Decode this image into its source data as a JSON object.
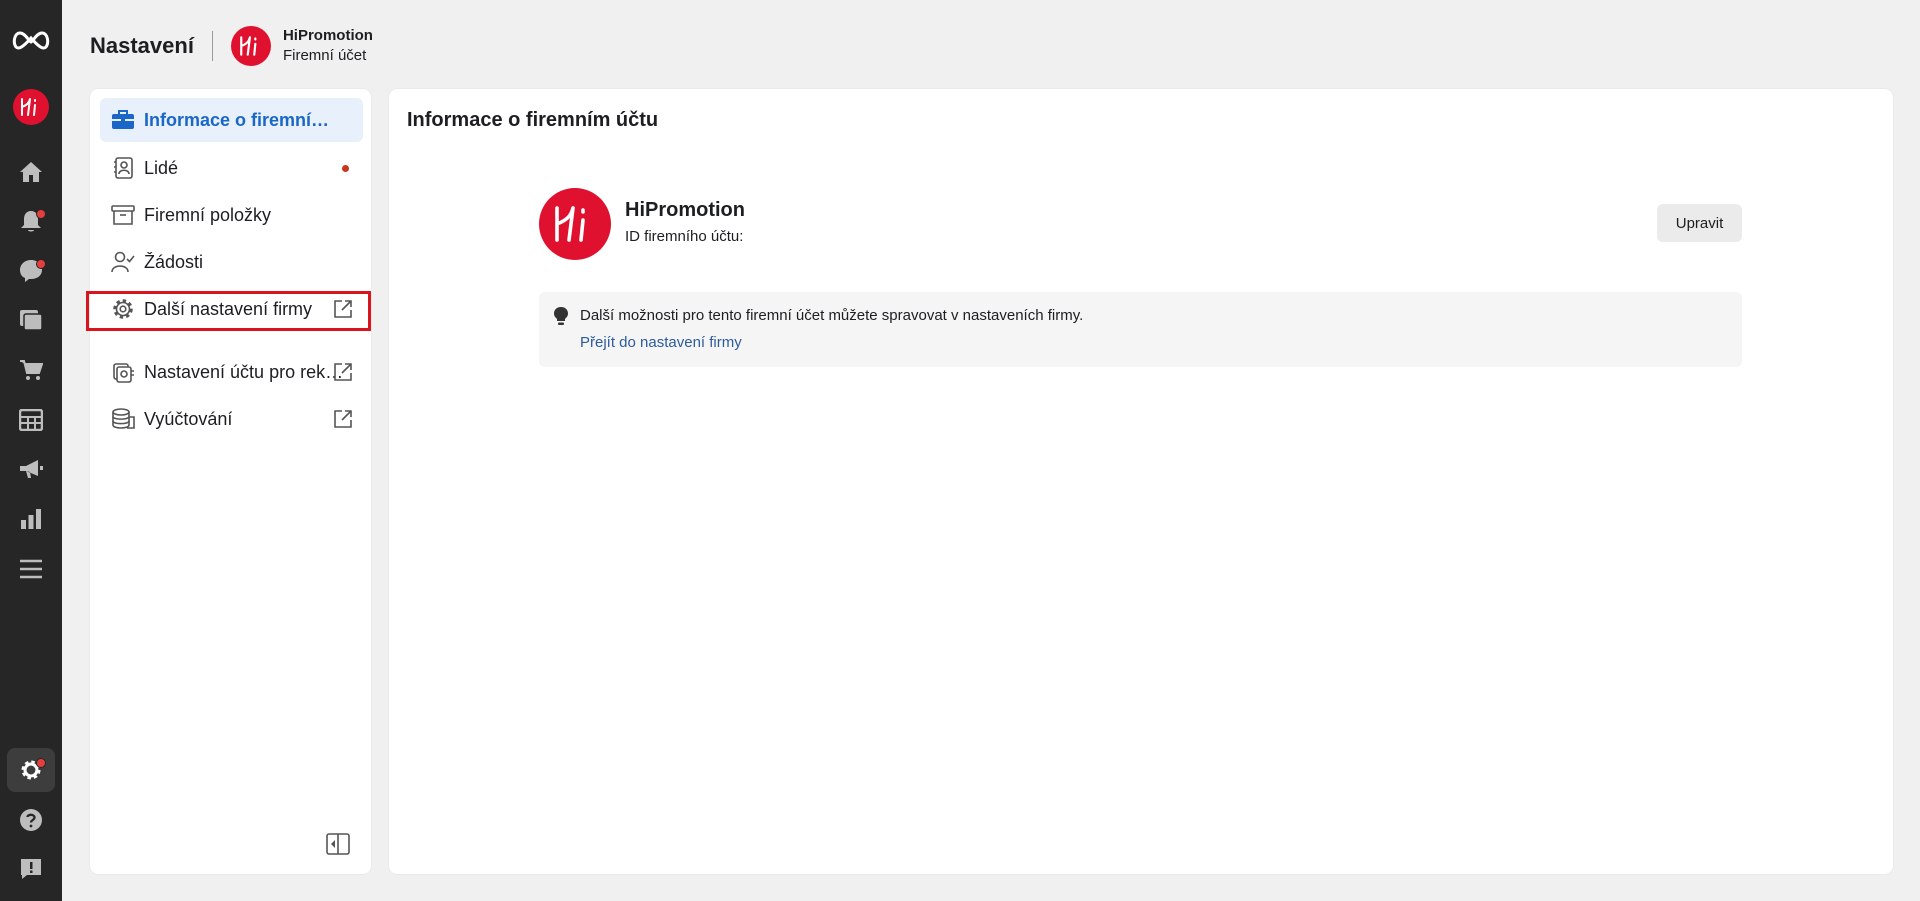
{
  "header": {
    "title": "Nastavení",
    "business_name": "HiPromotion",
    "business_type": "Firemní účet",
    "avatar_text": "Hi"
  },
  "rail": {
    "icons": [
      "meta-logo-icon",
      "business-avatar",
      "home-icon",
      "notifications-icon",
      "messages-icon",
      "pages-icon",
      "shop-icon",
      "table-icon",
      "ads-icon",
      "insights-icon",
      "menu-icon",
      "settings-icon",
      "help-icon",
      "feedback-icon"
    ]
  },
  "sidebar": {
    "items": [
      {
        "label": "Informace o firemním účtu",
        "icon": "briefcase-icon",
        "selected": true
      },
      {
        "label": "Lidé",
        "icon": "people-icon",
        "badge": true
      },
      {
        "label": "Firemní položky",
        "icon": "archive-icon"
      },
      {
        "label": "Žádosti",
        "icon": "person-check-icon"
      },
      {
        "label": "Další nastavení firmy",
        "icon": "gear-icon",
        "external": true
      },
      {
        "label": "Nastavení účtu pro reklamy",
        "icon": "ad-account-icon",
        "external": true
      },
      {
        "label": "Vyúčtování",
        "icon": "billing-icon",
        "external": true
      }
    ]
  },
  "main": {
    "title": "Informace o firemním účtu",
    "business_name": "HiPromotion",
    "business_id_label": "ID firemního účtu:",
    "edit_label": "Upravit",
    "info_text": "Další možnosti pro tento firemní účet můžete spravovat v nastaveních firmy.",
    "info_link": "Přejít do nastavení firmy"
  },
  "colors": {
    "accent": "#1b67c8",
    "brand": "#e0102f",
    "rail_bg": "#262626",
    "highlight": "#d9141e"
  }
}
